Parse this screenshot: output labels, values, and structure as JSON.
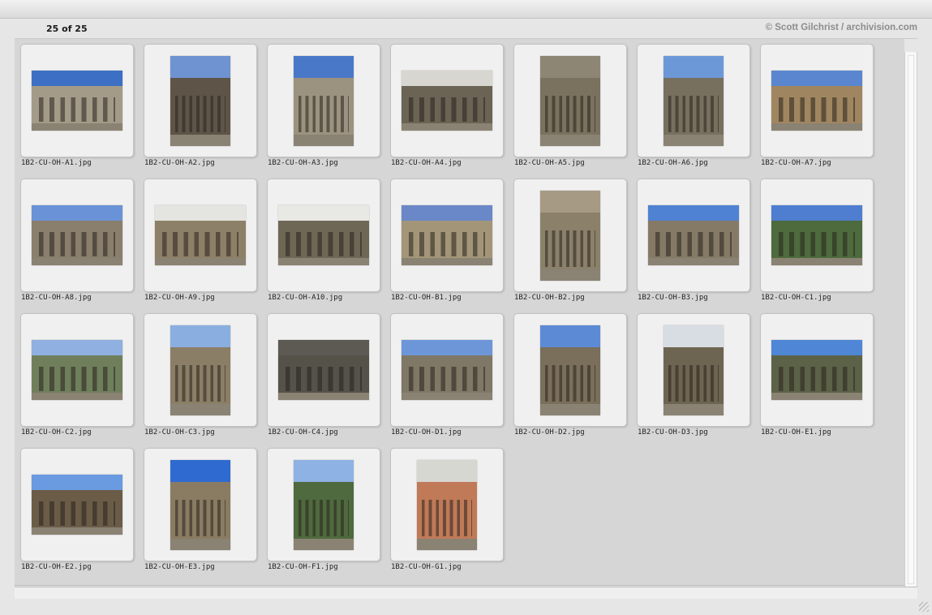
{
  "header": {
    "count_text": "25 of 25",
    "credit_text": "© Scott Gilchrist / archivision.com"
  },
  "thumbnails": [
    {
      "filename": "1B2-CU-OH-A1.jpg",
      "orientation": "landscape",
      "sky": "#3d6fc4",
      "building": "#a49a88"
    },
    {
      "filename": "1B2-CU-OH-A2.jpg",
      "orientation": "portrait",
      "sky": "#6f92d0",
      "building": "#5e5548"
    },
    {
      "filename": "1B2-CU-OH-A3.jpg",
      "orientation": "portrait",
      "sky": "#4a78c8",
      "building": "#9c9280"
    },
    {
      "filename": "1B2-CU-OH-A4.jpg",
      "orientation": "landscape",
      "sky": "#d8d6d0",
      "building": "#6b6455"
    },
    {
      "filename": "1B2-CU-OH-A5.jpg",
      "orientation": "portrait",
      "sky": "#8e8674",
      "building": "#7a715f"
    },
    {
      "filename": "1B2-CU-OH-A6.jpg",
      "orientation": "portrait",
      "sky": "#6d98d8",
      "building": "#77705f"
    },
    {
      "filename": "1B2-CU-OH-A7.jpg",
      "orientation": "landscape",
      "sky": "#5a86cf",
      "building": "#a08660"
    },
    {
      "filename": "1B2-CU-OH-A8.jpg",
      "orientation": "landscape",
      "sky": "#6a92d6",
      "building": "#8a7f6c"
    },
    {
      "filename": "1B2-CU-OH-A9.jpg",
      "orientation": "landscape",
      "sky": "#e4e4e0",
      "building": "#8d8068"
    },
    {
      "filename": "1B2-CU-OH-A10.jpg",
      "orientation": "landscape",
      "sky": "#e8e8e4",
      "building": "#6f6756"
    },
    {
      "filename": "1B2-CU-OH-B1.jpg",
      "orientation": "landscape",
      "sky": "#6a88c8",
      "building": "#a39578"
    },
    {
      "filename": "1B2-CU-OH-B2.jpg",
      "orientation": "portrait",
      "sky": "#a69a84",
      "building": "#8b806a"
    },
    {
      "filename": "1B2-CU-OH-B3.jpg",
      "orientation": "landscape",
      "sky": "#4f82d2",
      "building": "#857a66"
    },
    {
      "filename": "1B2-CU-OH-C1.jpg",
      "orientation": "landscape",
      "sky": "#4f7ed0",
      "building": "#4d6b3c"
    },
    {
      "filename": "1B2-CU-OH-C2.jpg",
      "orientation": "landscape",
      "sky": "#8fb0e0",
      "building": "#6f7f5c"
    },
    {
      "filename": "1B2-CU-OH-C3.jpg",
      "orientation": "portrait",
      "sky": "#8aaee0",
      "building": "#8b7e66"
    },
    {
      "filename": "1B2-CU-OH-C4.jpg",
      "orientation": "landscape",
      "sky": "#5c5a52",
      "building": "#55524a"
    },
    {
      "filename": "1B2-CU-OH-D1.jpg",
      "orientation": "landscape",
      "sky": "#6c96d8",
      "building": "#7f7866"
    },
    {
      "filename": "1B2-CU-OH-D2.jpg",
      "orientation": "portrait",
      "sky": "#5c8ad4",
      "building": "#7a6f5b"
    },
    {
      "filename": "1B2-CU-OH-D3.jpg",
      "orientation": "portrait",
      "sky": "#d8dde4",
      "building": "#6e6452"
    },
    {
      "filename": "1B2-CU-OH-E1.jpg",
      "orientation": "landscape",
      "sky": "#4f86d6",
      "building": "#5c6248"
    },
    {
      "filename": "1B2-CU-OH-E2.jpg",
      "orientation": "landscape",
      "sky": "#6a9ae0",
      "building": "#6b5c48"
    },
    {
      "filename": "1B2-CU-OH-E3.jpg",
      "orientation": "portrait",
      "sky": "#2f6ad0",
      "building": "#8a7c62"
    },
    {
      "filename": "1B2-CU-OH-F1.jpg",
      "orientation": "portrait",
      "sky": "#8fb2e4",
      "building": "#4f6a3e"
    },
    {
      "filename": "1B2-CU-OH-G1.jpg",
      "orientation": "portrait",
      "sky": "#d7d7d2",
      "building": "#c07a58"
    }
  ]
}
